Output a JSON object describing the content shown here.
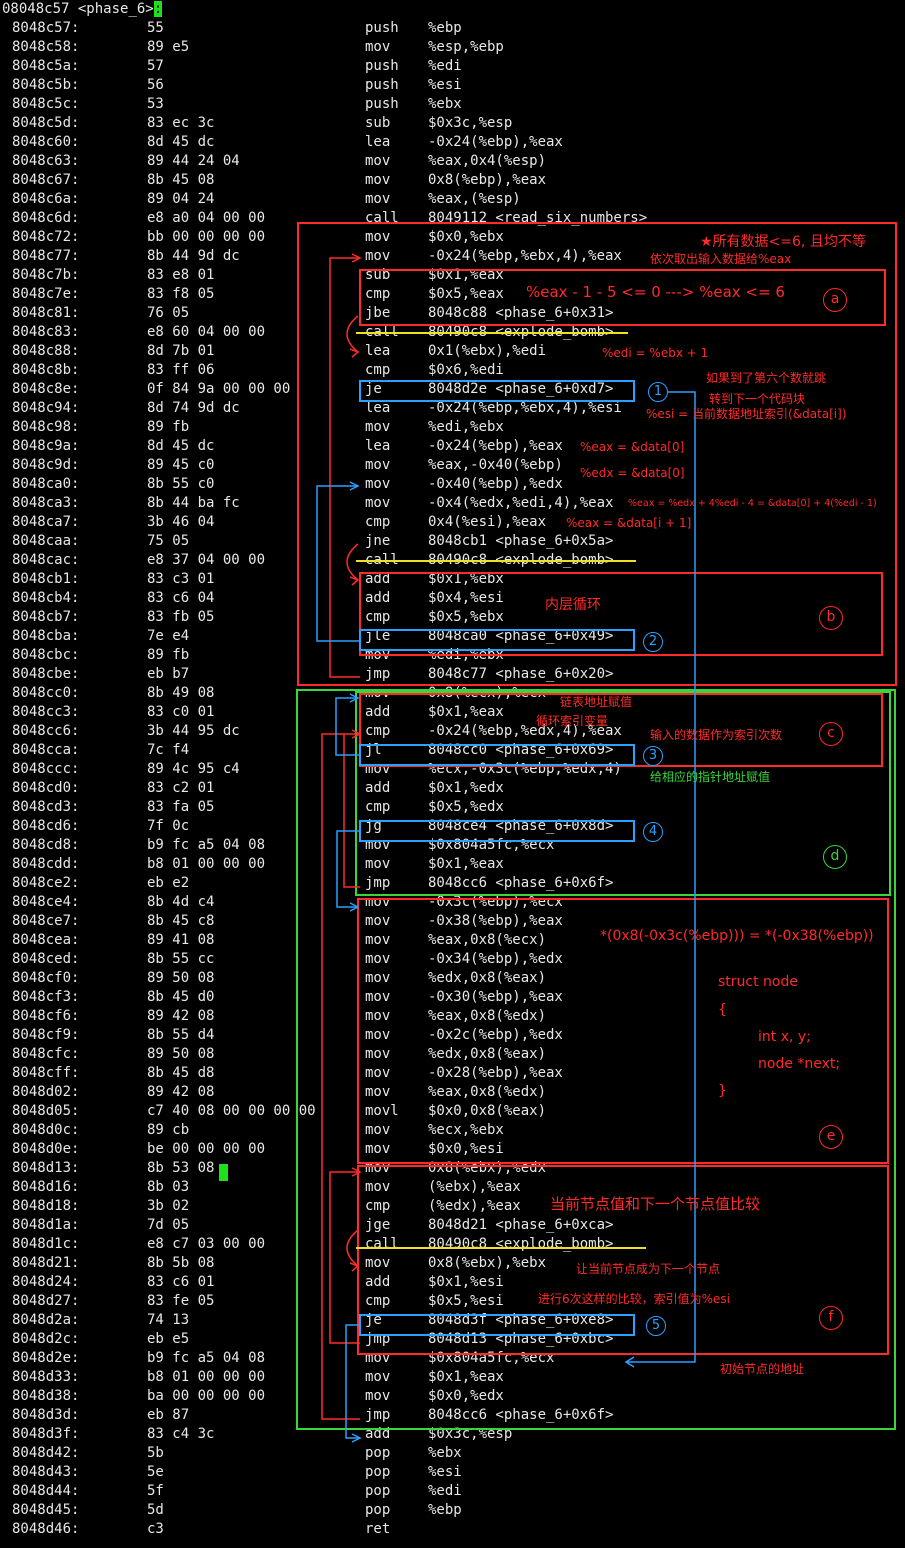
{
  "header": {
    "address": "08048c57",
    "label": "<phase_6>",
    "colon": ":"
  },
  "disasm": [
    {
      "addr": "8048c57:",
      "bytes": "55",
      "mn": "push",
      "op": "%ebp"
    },
    {
      "addr": "8048c58:",
      "bytes": "89 e5",
      "mn": "mov",
      "op": "%esp,%ebp"
    },
    {
      "addr": "8048c5a:",
      "bytes": "57",
      "mn": "push",
      "op": "%edi"
    },
    {
      "addr": "8048c5b:",
      "bytes": "56",
      "mn": "push",
      "op": "%esi"
    },
    {
      "addr": "8048c5c:",
      "bytes": "53",
      "mn": "push",
      "op": "%ebx"
    },
    {
      "addr": "8048c5d:",
      "bytes": "83 ec 3c",
      "mn": "sub",
      "op": "$0x3c,%esp"
    },
    {
      "addr": "8048c60:",
      "bytes": "8d 45 dc",
      "mn": "lea",
      "op": "-0x24(%ebp),%eax"
    },
    {
      "addr": "8048c63:",
      "bytes": "89 44 24 04",
      "mn": "mov",
      "op": "%eax,0x4(%esp)"
    },
    {
      "addr": "8048c67:",
      "bytes": "8b 45 08",
      "mn": "mov",
      "op": "0x8(%ebp),%eax"
    },
    {
      "addr": "8048c6a:",
      "bytes": "89 04 24",
      "mn": "mov",
      "op": "%eax,(%esp)"
    },
    {
      "addr": "8048c6d:",
      "bytes": "e8 a0 04 00 00",
      "mn": "call",
      "op": "8049112 <read_six_numbers>"
    },
    {
      "addr": "8048c72:",
      "bytes": "bb 00 00 00 00",
      "mn": "mov",
      "op": "$0x0,%ebx"
    },
    {
      "addr": "8048c77:",
      "bytes": "8b 44 9d dc",
      "mn": "mov",
      "op": "-0x24(%ebp,%ebx,4),%eax"
    },
    {
      "addr": "8048c7b:",
      "bytes": "83 e8 01",
      "mn": "sub",
      "op": "$0x1,%eax"
    },
    {
      "addr": "8048c7e:",
      "bytes": "83 f8 05",
      "mn": "cmp",
      "op": "$0x5,%eax"
    },
    {
      "addr": "8048c81:",
      "bytes": "76 05",
      "mn": "jbe",
      "op": "8048c88 <phase_6+0x31>"
    },
    {
      "addr": "8048c83:",
      "bytes": "e8 60 04 00 00",
      "mn": "call",
      "op": "80490c8 <explode_bomb>"
    },
    {
      "addr": "8048c88:",
      "bytes": "8d 7b 01",
      "mn": "lea",
      "op": "0x1(%ebx),%edi"
    },
    {
      "addr": "8048c8b:",
      "bytes": "83 ff 06",
      "mn": "cmp",
      "op": "$0x6,%edi"
    },
    {
      "addr": "8048c8e:",
      "bytes": "0f 84 9a 00 00 00",
      "mn": "je",
      "op": "8048d2e <phase_6+0xd7>"
    },
    {
      "addr": "8048c94:",
      "bytes": "8d 74 9d dc",
      "mn": "lea",
      "op": "-0x24(%ebp,%ebx,4),%esi"
    },
    {
      "addr": "8048c98:",
      "bytes": "89 fb",
      "mn": "mov",
      "op": "%edi,%ebx"
    },
    {
      "addr": "8048c9a:",
      "bytes": "8d 45 dc",
      "mn": "lea",
      "op": "-0x24(%ebp),%eax"
    },
    {
      "addr": "8048c9d:",
      "bytes": "89 45 c0",
      "mn": "mov",
      "op": "%eax,-0x40(%ebp)"
    },
    {
      "addr": "8048ca0:",
      "bytes": "8b 55 c0",
      "mn": "mov",
      "op": "-0x40(%ebp),%edx"
    },
    {
      "addr": "8048ca3:",
      "bytes": "8b 44 ba fc",
      "mn": "mov",
      "op": "-0x4(%edx,%edi,4),%eax"
    },
    {
      "addr": "8048ca7:",
      "bytes": "3b 46 04",
      "mn": "cmp",
      "op": "0x4(%esi),%eax"
    },
    {
      "addr": "8048caa:",
      "bytes": "75 05",
      "mn": "jne",
      "op": "8048cb1 <phase_6+0x5a>"
    },
    {
      "addr": "8048cac:",
      "bytes": "e8 37 04 00 00",
      "mn": "call",
      "op": "80490c8 <explode_bomb>"
    },
    {
      "addr": "8048cb1:",
      "bytes": "83 c3 01",
      "mn": "add",
      "op": "$0x1,%ebx"
    },
    {
      "addr": "8048cb4:",
      "bytes": "83 c6 04",
      "mn": "add",
      "op": "$0x4,%esi"
    },
    {
      "addr": "8048cb7:",
      "bytes": "83 fb 05",
      "mn": "cmp",
      "op": "$0x5,%ebx"
    },
    {
      "addr": "8048cba:",
      "bytes": "7e e4",
      "mn": "jle",
      "op": "8048ca0 <phase_6+0x49>"
    },
    {
      "addr": "8048cbc:",
      "bytes": "89 fb",
      "mn": "mov",
      "op": "%edi,%ebx"
    },
    {
      "addr": "8048cbe:",
      "bytes": "eb b7",
      "mn": "jmp",
      "op": "8048c77 <phase_6+0x20>"
    },
    {
      "addr": "8048cc0:",
      "bytes": "8b 49 08",
      "mn": "mov",
      "op": "0x8(%ecx),%ecx"
    },
    {
      "addr": "8048cc3:",
      "bytes": "83 c0 01",
      "mn": "add",
      "op": "$0x1,%eax"
    },
    {
      "addr": "8048cc6:",
      "bytes": "3b 44 95 dc",
      "mn": "cmp",
      "op": "-0x24(%ebp,%edx,4),%eax"
    },
    {
      "addr": "8048cca:",
      "bytes": "7c f4",
      "mn": "jl",
      "op": "8048cc0 <phase_6+0x69>"
    },
    {
      "addr": "8048ccc:",
      "bytes": "89 4c 95 c4",
      "mn": "mov",
      "op": "%ecx,-0x3c(%ebp,%edx,4)"
    },
    {
      "addr": "8048cd0:",
      "bytes": "83 c2 01",
      "mn": "add",
      "op": "$0x1,%edx"
    },
    {
      "addr": "8048cd3:",
      "bytes": "83 fa 05",
      "mn": "cmp",
      "op": "$0x5,%edx"
    },
    {
      "addr": "8048cd6:",
      "bytes": "7f 0c",
      "mn": "jg",
      "op": "8048ce4 <phase_6+0x8d>"
    },
    {
      "addr": "8048cd8:",
      "bytes": "b9 fc a5 04 08",
      "mn": "mov",
      "op": "$0x804a5fc,%ecx"
    },
    {
      "addr": "8048cdd:",
      "bytes": "b8 01 00 00 00",
      "mn": "mov",
      "op": "$0x1,%eax"
    },
    {
      "addr": "8048ce2:",
      "bytes": "eb e2",
      "mn": "jmp",
      "op": "8048cc6 <phase_6+0x6f>"
    },
    {
      "addr": "8048ce4:",
      "bytes": "8b 4d c4",
      "mn": "mov",
      "op": "-0x3c(%ebp),%ecx"
    },
    {
      "addr": "8048ce7:",
      "bytes": "8b 45 c8",
      "mn": "mov",
      "op": "-0x38(%ebp),%eax"
    },
    {
      "addr": "8048cea:",
      "bytes": "89 41 08",
      "mn": "mov",
      "op": "%eax,0x8(%ecx)"
    },
    {
      "addr": "8048ced:",
      "bytes": "8b 55 cc",
      "mn": "mov",
      "op": "-0x34(%ebp),%edx"
    },
    {
      "addr": "8048cf0:",
      "bytes": "89 50 08",
      "mn": "mov",
      "op": "%edx,0x8(%eax)"
    },
    {
      "addr": "8048cf3:",
      "bytes": "8b 45 d0",
      "mn": "mov",
      "op": "-0x30(%ebp),%eax"
    },
    {
      "addr": "8048cf6:",
      "bytes": "89 42 08",
      "mn": "mov",
      "op": "%eax,0x8(%edx)"
    },
    {
      "addr": "8048cf9:",
      "bytes": "8b 55 d4",
      "mn": "mov",
      "op": "-0x2c(%ebp),%edx"
    },
    {
      "addr": "8048cfc:",
      "bytes": "89 50 08",
      "mn": "mov",
      "op": "%edx,0x8(%eax)"
    },
    {
      "addr": "8048cff:",
      "bytes": "8b 45 d8",
      "mn": "mov",
      "op": "-0x28(%ebp),%eax"
    },
    {
      "addr": "8048d02:",
      "bytes": "89 42 08",
      "mn": "mov",
      "op": "%eax,0x8(%edx)"
    },
    {
      "addr": "8048d05:",
      "bytes": "c7 40 08 00 00 00 00",
      "mn": "movl",
      "op": "$0x0,0x8(%eax)"
    },
    {
      "addr": "8048d0c:",
      "bytes": "89 cb",
      "mn": "mov",
      "op": "%ecx,%ebx"
    },
    {
      "addr": "8048d0e:",
      "bytes": "be 00 00 00 00",
      "mn": "mov",
      "op": "$0x0,%esi"
    },
    {
      "addr": "8048d13:",
      "bytes": "8b 53 08",
      "mn": "mov",
      "op": "0x8(%ebx),%edx"
    },
    {
      "addr": "8048d16:",
      "bytes": "8b 03",
      "mn": "mov",
      "op": "(%ebx),%eax"
    },
    {
      "addr": "8048d18:",
      "bytes": "3b 02",
      "mn": "cmp",
      "op": "(%edx),%eax"
    },
    {
      "addr": "8048d1a:",
      "bytes": "7d 05",
      "mn": "jge",
      "op": "8048d21 <phase_6+0xca>"
    },
    {
      "addr": "8048d1c:",
      "bytes": "e8 c7 03 00 00",
      "mn": "call",
      "op": "80490c8 <explode_bomb>"
    },
    {
      "addr": "8048d21:",
      "bytes": "8b 5b 08",
      "mn": "mov",
      "op": "0x8(%ebx),%ebx"
    },
    {
      "addr": "8048d24:",
      "bytes": "83 c6 01",
      "mn": "add",
      "op": "$0x1,%esi"
    },
    {
      "addr": "8048d27:",
      "bytes": "83 fe 05",
      "mn": "cmp",
      "op": "$0x5,%esi"
    },
    {
      "addr": "8048d2a:",
      "bytes": "74 13",
      "mn": "je",
      "op": "8048d3f <phase_6+0xe8>"
    },
    {
      "addr": "8048d2c:",
      "bytes": "eb e5",
      "mn": "jmp",
      "op": "8048d13 <phase_6+0xbc>"
    },
    {
      "addr": "8048d2e:",
      "bytes": "b9 fc a5 04 08",
      "mn": "mov",
      "op": "$0x804a5fc,%ecx"
    },
    {
      "addr": "8048d33:",
      "bytes": "b8 01 00 00 00",
      "mn": "mov",
      "op": "$0x1,%eax"
    },
    {
      "addr": "8048d38:",
      "bytes": "ba 00 00 00 00",
      "mn": "mov",
      "op": "$0x0,%edx"
    },
    {
      "addr": "8048d3d:",
      "bytes": "eb 87",
      "mn": "jmp",
      "op": "8048cc6 <phase_6+0x6f>"
    },
    {
      "addr": "8048d3f:",
      "bytes": "83 c4 3c",
      "mn": "add",
      "op": "$0x3c,%esp"
    },
    {
      "addr": "8048d42:",
      "bytes": "5b",
      "mn": "pop",
      "op": "%ebx"
    },
    {
      "addr": "8048d43:",
      "bytes": "5e",
      "mn": "pop",
      "op": "%esi"
    },
    {
      "addr": "8048d44:",
      "bytes": "5f",
      "mn": "pop",
      "op": "%edi"
    },
    {
      "addr": "8048d45:",
      "bytes": "5d",
      "mn": "pop",
      "op": "%ebp"
    },
    {
      "addr": "8048d46:",
      "bytes": "c3",
      "mn": "ret",
      "op": ""
    }
  ],
  "annotations": {
    "all_data_condition": "★所有数据<=6, 且均不等",
    "fetch_input": "依次取出输入数据给%eax",
    "eax_range": "%eax - 1 - 5 <= 0 ---> %eax <= 6",
    "edi_eq": "%edi = %ebx + 1",
    "if_sixth": "如果到了第六个数就跳",
    "goto_next_block": "转到下一个代码块",
    "esi_eq": "%esi = 当前数据地址索引(&data[i])",
    "eax_data0": "%eax = &data[0]",
    "edx_data0": "%edx = &data[0]",
    "eax_formula": "%eax = %edx + 4%edi - 4 = &data[0] + 4(%edi - 1)",
    "eax_data_i1": "%eax = &data[i + 1]",
    "inner_loop": "内层循环",
    "list_addr_assign": "链表地址赋值",
    "loop_index": "循环索引变量",
    "input_as_count": "输入的数据作为索引次数",
    "assign_pointer": "给相应的指针地址赋值",
    "node_link_expr": "*(0x8(-0x3c(%ebp))) = *(-0x38(%ebp))",
    "struct_l1": "struct node",
    "struct_l2": "{",
    "struct_l3": "int x, y;",
    "struct_l4": "node *next;",
    "struct_l5": "}",
    "compare_nodes": "当前节点值和下一个节点值比较",
    "advance_node": "让当前节点成为下一个节点",
    "six_compares": "进行6次这样的比较，索引值为%esi",
    "initial_node": "初始节点的地址"
  },
  "markers": {
    "blue": [
      "1",
      "2",
      "3",
      "4",
      "5"
    ],
    "red": [
      "a",
      "b",
      "c",
      "e",
      "f"
    ],
    "green": [
      "d"
    ]
  },
  "colors": {
    "background": "#000000",
    "text": "#e8e8e8",
    "red": "#ff2a2a",
    "blue": "#2aa0ff",
    "green": "#39d639",
    "yellow": "#f0e020",
    "cursor": "#1ee11e"
  }
}
